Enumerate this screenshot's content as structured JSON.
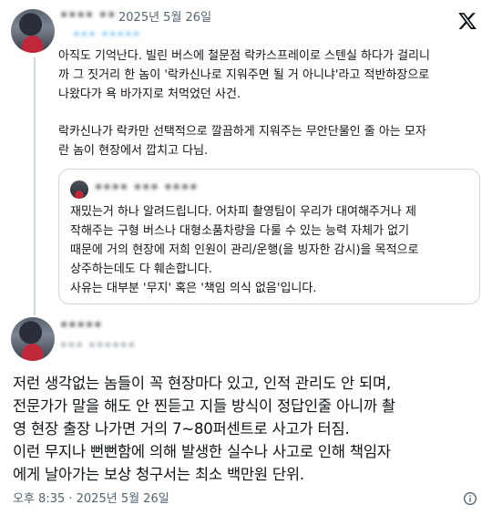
{
  "post1": {
    "user_name": "•••• ••",
    "date": "2025년 5월 26일",
    "handle": "••• •••••",
    "body_lines": [
      "아직도 기억난다. 빌린 버스에 철문점 락카스프레이로 스텐실 하다가 걸리니",
      "까 그 짓거리 한 놈이 '락카신나로 지워주면 될 거 아니냐'라고 적반하장으로",
      "나왔다가 욕 바가지로 처먹었던 사건.",
      "락카신나가 락카만 선택적으로 깔끔하게 지워주는 무안단물인 줄 아는 모자",
      "란 놈이 현장에서 깝치고 다님."
    ]
  },
  "quote": {
    "user_name": "•••• ••• ••••",
    "body_lines": [
      "재밌는거 하나 알려드립니다. 어차피 촬영팀이 우리가 대여해주거나 제",
      "작해주는 구형 버스나 대형소품차량을 다룰 수 있는 능력 자체가 없기",
      "때문에 거의 현장에 저희 인원이 관리/운행(을 빙자한 감시)을 목적으로",
      "상주하는데도 다 훼손합니다.",
      "사유는 대부분 '무지' 혹은 '책임 의식 없음'입니다."
    ]
  },
  "post2": {
    "user_name": "•••••",
    "handle": "••• ••••••",
    "body_lines": [
      "저런 생각없는 놈들이 꼭 현장마다 있고, 인적 관리도 안 되며,",
      "전문가가 말을 해도 안 찐듣고 지들 방식이 정답인줄 아니까 촬",
      "영 현장 출장 나가면 거의 7~80퍼센트로 사고가 터짐.",
      "이런 무지나 뻔뻔함에 의해 발생한 실수나 사고로 인해 책임자",
      "에게 날아가는 보상 청구서는 최소 백만원 단위."
    ],
    "timestamp": "오후 8:35 · 2025년 5월 26일"
  },
  "icons": {
    "platform": "x-logo-icon",
    "info": "info-icon"
  }
}
